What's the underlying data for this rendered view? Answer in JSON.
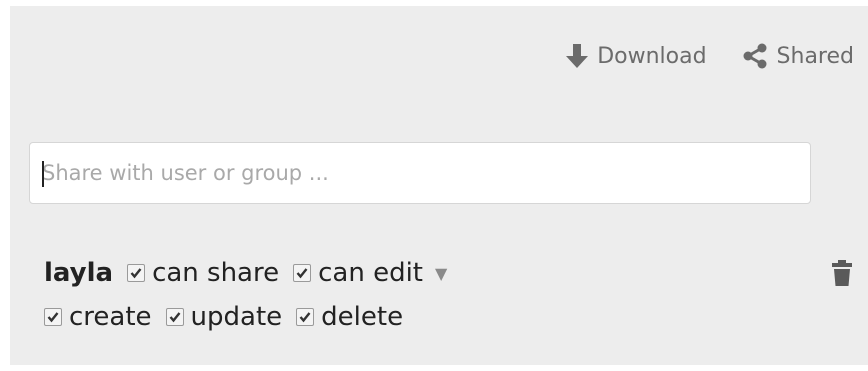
{
  "toolbar": {
    "download_label": "Download",
    "download_icon": "download-icon",
    "shared_label": "Shared",
    "shared_icon": "share-icon"
  },
  "share": {
    "placeholder": "Share with user or group ...",
    "value": ""
  },
  "entry": {
    "username": "layla",
    "permissions": {
      "can_share": {
        "label": "can share",
        "checked": true
      },
      "can_edit": {
        "label": "can edit",
        "checked": true
      },
      "create": {
        "label": "create",
        "checked": true
      },
      "update": {
        "label": "update",
        "checked": true
      },
      "delete": {
        "label": "delete",
        "checked": true
      }
    },
    "dropdown_icon": "caret-down-icon",
    "remove_icon": "trash-icon"
  }
}
